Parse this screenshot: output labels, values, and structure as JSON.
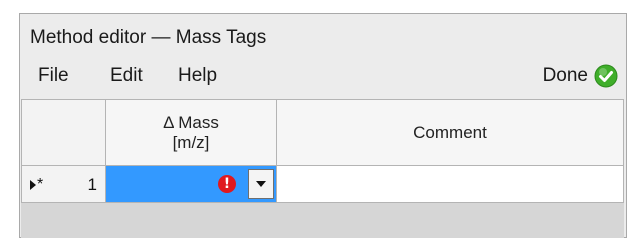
{
  "window": {
    "title": "Method editor — Mass Tags"
  },
  "menu": {
    "items": [
      "File",
      "Edit",
      "Help"
    ],
    "done_label": "Done",
    "done_icon": "check-circle-icon",
    "done_color": "#3fae2a"
  },
  "grid": {
    "columns": [
      {
        "line1": "Δ Mass",
        "line2": "[m/z]"
      },
      {
        "line1": "Comment"
      }
    ],
    "rows": [
      {
        "indicator": "▸*",
        "number": "1",
        "mass_value": "",
        "mass_error_icon": "error-icon",
        "comment": ""
      }
    ],
    "selection_color": "#3399ff",
    "error_color": "#e0191f"
  }
}
